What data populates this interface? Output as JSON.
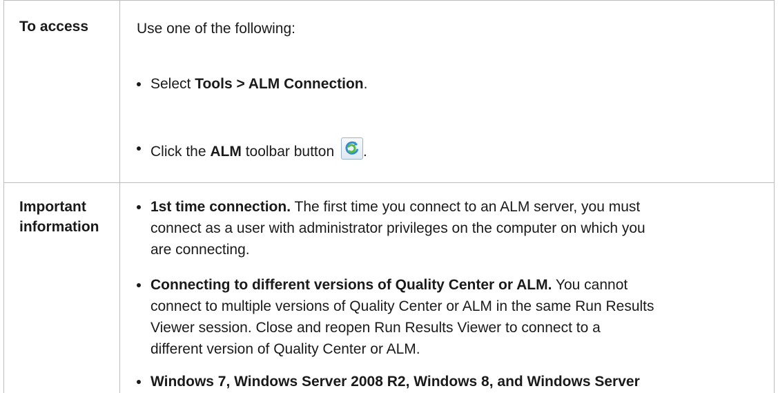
{
  "rows": [
    {
      "label": "To access",
      "intro": "Use one of the following:",
      "bullets": [
        {
          "pre": "Select ",
          "bold": "Tools > ALM Connection",
          "post": "."
        },
        {
          "pre": "Click the ",
          "bold": "ALM",
          "post": " toolbar button",
          "after_icon": ".",
          "icon": "alm-connection-icon"
        }
      ]
    },
    {
      "label_line1": "Important",
      "label_line2": "information",
      "bullets": [
        {
          "bold": "1st time connection.",
          "lines": [
            " The first time you connect to an ALM server, you must",
            "connect as a user with administrator privileges on the computer on which you",
            "are connecting."
          ]
        },
        {
          "bold": "Connecting to different versions of Quality Center or ALM.",
          "lines": [
            " You cannot",
            "connect to multiple versions of Quality Center or ALM in the same Run Results",
            "Viewer session. Close and reopen Run Results Viewer to connect to a",
            "different version of Quality Center or ALM."
          ]
        },
        {
          "bold": "Windows 7, Windows Server 2008 R2, Windows 8, and Windows Server"
        }
      ]
    }
  ]
}
